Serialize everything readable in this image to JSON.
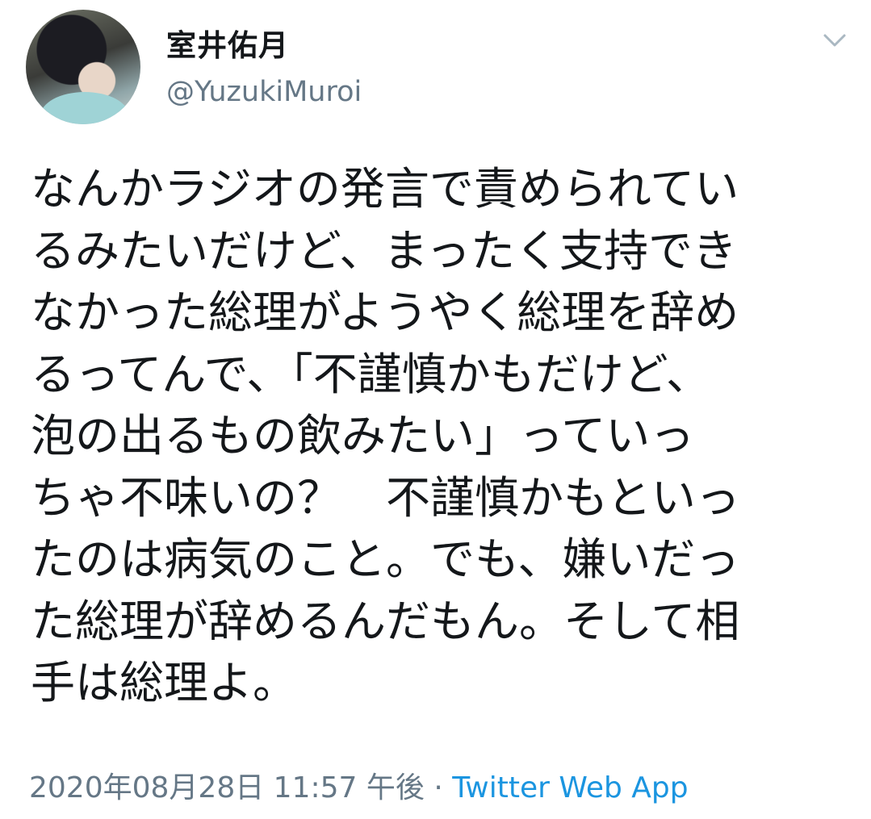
{
  "tweet": {
    "display_name": "室井佑月",
    "handle": "@YuzukiMuroi",
    "text": "なんかラジオの発言で責められてい\nるみたいだけど、まったく支持でき\nなかった総理がようやく総理を辞め\nるってんで、「不謹慎かもだけど、\n泡の出るもの飲みたい」っていっ\nちゃ不味いの？　不謹慎かもといっ\nたのは病気のこと。でも、嫌いだっ\nた総理が辞めるんだもん。そして相\n手は総理よ。",
    "timestamp": "2020年08月28日 11:57 午後",
    "separator": "·",
    "source": "Twitter Web App"
  },
  "icons": {
    "menu_caret": "chevron-down-icon"
  },
  "colors": {
    "text": "#14171a",
    "secondary": "#657786",
    "link": "#1b95e0"
  }
}
